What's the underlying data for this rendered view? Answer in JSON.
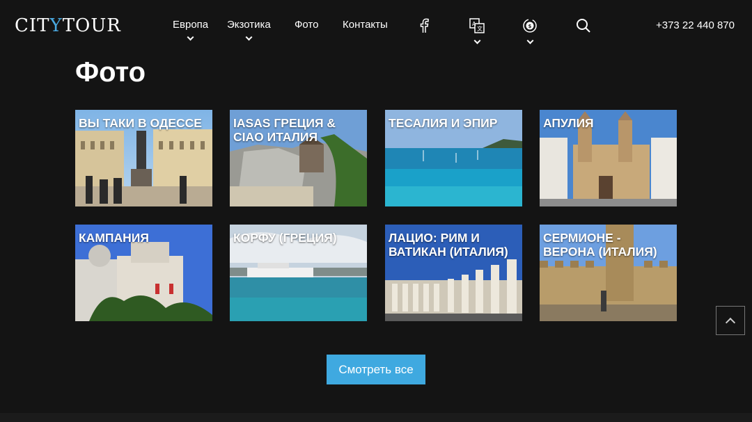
{
  "header": {
    "logo": {
      "part1": "CIT",
      "part2": "Y",
      "part3": "TOUR"
    },
    "nav": [
      {
        "label": "Европа"
      },
      {
        "label": "Экзотика"
      },
      {
        "label": "Фото"
      },
      {
        "label": "Контакты"
      }
    ],
    "phone": "+373 22 440 870"
  },
  "page_title": "Фото",
  "gallery": [
    {
      "label": "ВЫ ТАКИ В ОДЕССЕ"
    },
    {
      "label": "IASAS ГРЕЦИЯ & CIAO ИТАЛИЯ"
    },
    {
      "label": "ТЕСАЛИЯ И ЭПИР"
    },
    {
      "label": "АПУЛИЯ"
    },
    {
      "label": "КАМПАНИЯ"
    },
    {
      "label": "КОРФУ (ГРЕЦИЯ)"
    },
    {
      "label": "ЛАЦИО: РИМ И ВАТИКАН (ИТАЛИЯ)"
    },
    {
      "label": "СЕРМИОНЕ - ВЕРОНА (ИТАЛИЯ)"
    }
  ],
  "view_all_label": "Смотреть все",
  "colors": {
    "background": "#141414",
    "accent": "#3fa9e0"
  }
}
